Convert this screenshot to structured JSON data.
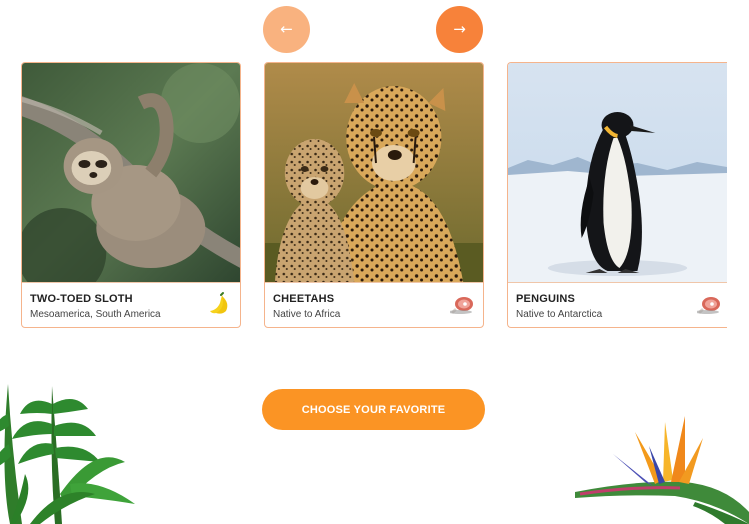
{
  "nav": {
    "prev_label": "←",
    "next_label": "→"
  },
  "cards": [
    {
      "name": "TWO-TOED SLOTH",
      "origin": "Mesoamerica, South America",
      "food_icon": "banana-icon"
    },
    {
      "name": "CHEETAHS",
      "origin": "Native to Africa",
      "food_icon": "meat-icon"
    },
    {
      "name": "PENGUINS",
      "origin": "Native to Antarctica",
      "food_icon": "meat-icon"
    }
  ],
  "cta": {
    "label": "CHOOSE YOUR FAVORITE"
  },
  "colors": {
    "accent": "#fb9424",
    "nav_prev": "#f9b27f",
    "nav_next": "#f7823a",
    "card_border": "#f5b48c"
  }
}
